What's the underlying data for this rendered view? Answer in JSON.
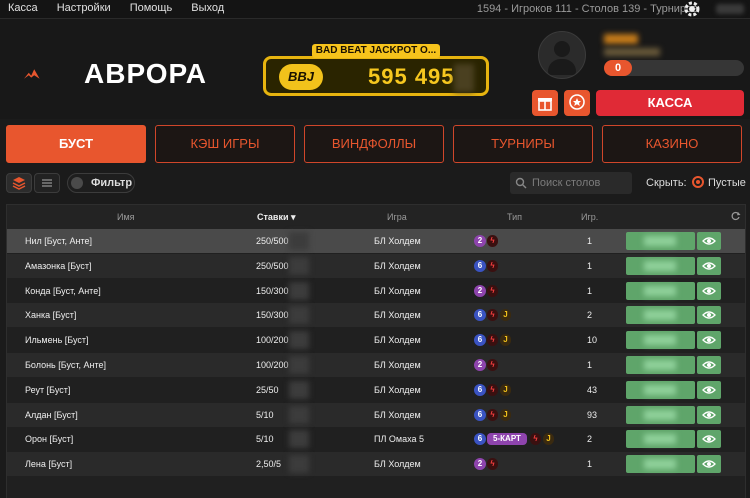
{
  "topbar": {
    "menu": [
      "Касса",
      "Настройки",
      "Помощь",
      "Выход"
    ],
    "stats": "1594 - Игроков  111 - Столов  139 - Турниров"
  },
  "brand": {
    "name": "АВРОРА",
    "accent": "#e8562e"
  },
  "jackpot": {
    "label": "BAD BEAT JACKPOT O...",
    "badge": "BBJ",
    "amount": "595 495"
  },
  "user": {
    "balance": "0"
  },
  "cashier_button": "КАССА",
  "tabs": [
    {
      "label": "БУСТ",
      "active": true
    },
    {
      "label": "КЭШ ИГРЫ",
      "active": false
    },
    {
      "label": "ВИНДФОЛЛЫ",
      "active": false
    },
    {
      "label": "ТУРНИРЫ",
      "active": false
    },
    {
      "label": "КАЗИНО",
      "active": false
    }
  ],
  "filters": {
    "filter_label": "Фильтр",
    "search_placeholder": "Поиск столов",
    "hide_label": "Скрыть:",
    "empty_label": "Пустые"
  },
  "table": {
    "headers": {
      "name": "Имя",
      "stakes": "Ставки",
      "game": "Игра",
      "type": "Тип",
      "players": "Игр."
    },
    "rows": [
      {
        "name": "Нил [Буст, Анте]",
        "stakes": "250/500",
        "game": "БЛ Холдем",
        "type_num": "2",
        "type_color": "purple",
        "extras": [
          "bolt"
        ],
        "players": "1"
      },
      {
        "name": "Амазонка [Буст]",
        "stakes": "250/500",
        "game": "БЛ Холдем",
        "type_num": "6",
        "type_color": "blue",
        "extras": [
          "bolt"
        ],
        "players": "1"
      },
      {
        "name": "Конда [Буст, Анте]",
        "stakes": "150/300",
        "game": "БЛ Холдем",
        "type_num": "2",
        "type_color": "purple",
        "extras": [
          "bolt"
        ],
        "players": "1"
      },
      {
        "name": "Ханка [Буст]",
        "stakes": "150/300",
        "game": "БЛ Холдем",
        "type_num": "6",
        "type_color": "blue",
        "extras": [
          "bolt",
          "joker"
        ],
        "players": "2"
      },
      {
        "name": "Ильмень [Буст]",
        "stakes": "100/200",
        "game": "БЛ Холдем",
        "type_num": "6",
        "type_color": "blue",
        "extras": [
          "bolt",
          "joker"
        ],
        "players": "10"
      },
      {
        "name": "Болонь [Буст, Анте]",
        "stakes": "100/200",
        "game": "БЛ Холдем",
        "type_num": "2",
        "type_color": "purple",
        "extras": [
          "bolt"
        ],
        "players": "1"
      },
      {
        "name": "Реут [Буст]",
        "stakes": "25/50",
        "game": "БЛ Холдем",
        "type_num": "6",
        "type_color": "blue",
        "extras": [
          "bolt",
          "joker"
        ],
        "players": "43"
      },
      {
        "name": "Алдан [Буст]",
        "stakes": "5/10",
        "game": "БЛ Холдем",
        "type_num": "6",
        "type_color": "blue",
        "extras": [
          "bolt",
          "joker"
        ],
        "players": "93"
      },
      {
        "name": "Орон [Буст]",
        "stakes": "5/10",
        "game": "ПЛ Омаха 5",
        "type_num": "6",
        "type_color": "blue",
        "extras": [
          "kart",
          "bolt",
          "joker"
        ],
        "players": "2"
      },
      {
        "name": "Лена [Буст]",
        "stakes": "2,50/5",
        "game": "БЛ Холдем",
        "type_num": "2",
        "type_color": "purple",
        "extras": [
          "bolt"
        ],
        "players": "1"
      }
    ],
    "kart_label": "5-КАРТ",
    "joker_label": "J",
    "bolt_label": "ϟ"
  }
}
